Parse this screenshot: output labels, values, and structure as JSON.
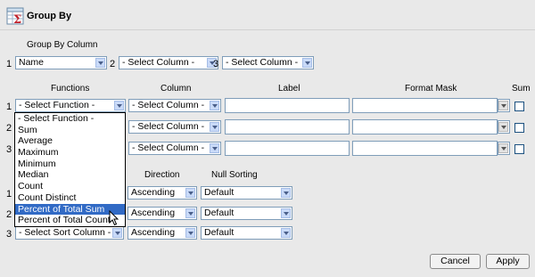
{
  "header": {
    "title": "Group By",
    "icon": "sigma-table-icon"
  },
  "group_by": {
    "label": "Group By Column",
    "items": [
      {
        "num": "1",
        "value": "Name"
      },
      {
        "num": "2",
        "value": "- Select Column -"
      },
      {
        "num": "3",
        "value": "- Select Column -"
      }
    ]
  },
  "functions_table": {
    "headers": {
      "functions": "Functions",
      "column": "Column",
      "label": "Label",
      "format_mask": "Format Mask",
      "sum": "Sum"
    },
    "rows": [
      {
        "num": "1",
        "function": "- Select Function -",
        "column": "- Select Column -"
      },
      {
        "num": "2",
        "column": "- Select Column -"
      },
      {
        "num": "3",
        "column": "- Select Column -"
      }
    ]
  },
  "function_dropdown": {
    "options": [
      "- Select Function -",
      "Sum",
      "Average",
      "Maximum",
      "Minimum",
      "Median",
      "Count",
      "Count Distinct",
      "Percent of Total Sum",
      "Percent of Total Count"
    ],
    "highlighted": "Percent of Total Sum"
  },
  "sort_table": {
    "headers": {
      "direction": "Direction",
      "null_sorting": "Null Sorting"
    },
    "rows": [
      {
        "num": "1",
        "direction": "Ascending",
        "null_sorting": "Default"
      },
      {
        "num": "2",
        "direction": "Ascending",
        "null_sorting": "Default"
      },
      {
        "num": "3",
        "column": "- Select Sort Column -",
        "direction": "Ascending",
        "null_sorting": "Default"
      }
    ]
  },
  "buttons": {
    "cancel": "Cancel",
    "apply": "Apply"
  },
  "colors": {
    "highlight": "#316ac5",
    "background": "#e9e9e9",
    "border": "#7f9db9"
  }
}
